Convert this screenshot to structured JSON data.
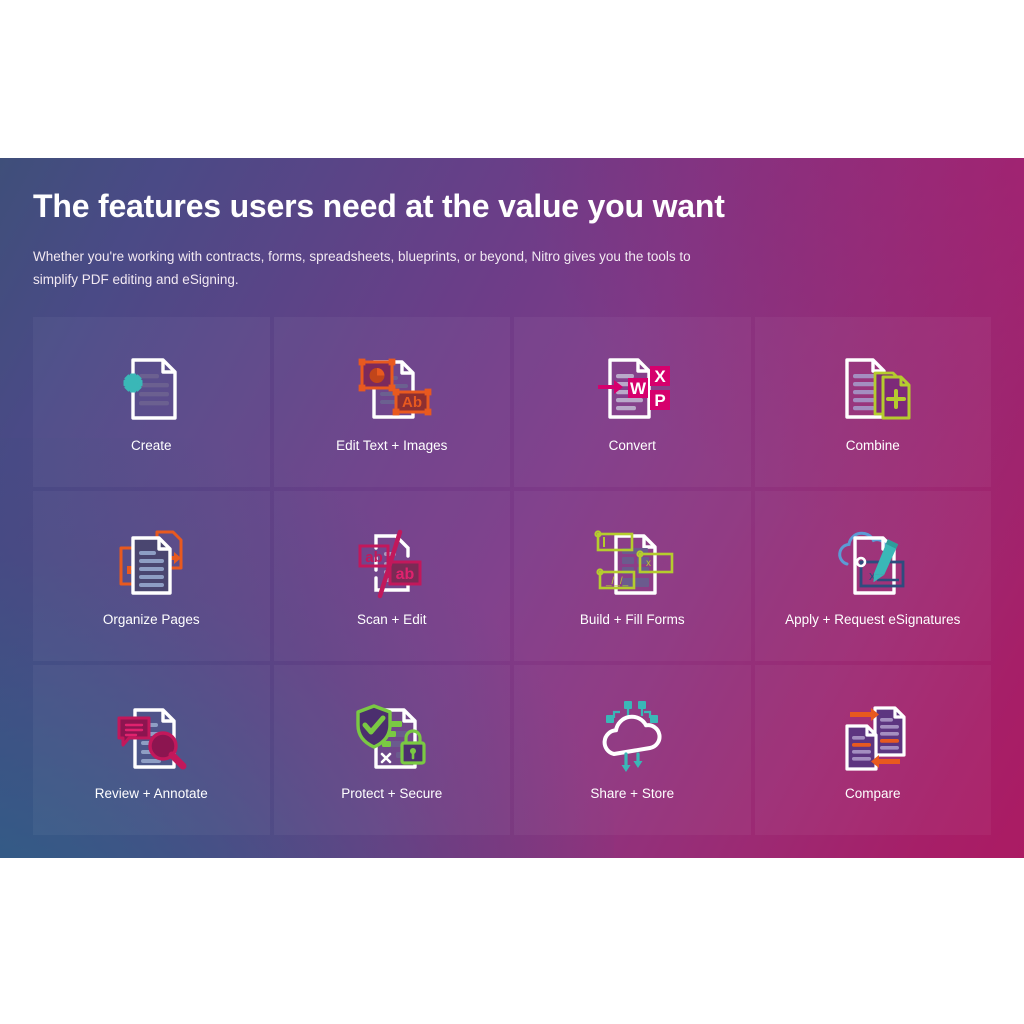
{
  "hero": {
    "title": "The features users need at the value you want",
    "subtitle": "Whether you're working with contracts, forms, spreadsheets, blueprints, or beyond, Nitro gives you the tools to simplify PDF editing and eSigning."
  },
  "colors": {
    "gradient_start": "#3f4f7a",
    "gradient_mid": "#7d3a88",
    "gradient_end": "#ab1b63",
    "teal": "#3ab7b7",
    "orange": "#e8591f",
    "magenta": "#d6006d",
    "crimson": "#c2185b",
    "lime": "#b5cc2e",
    "green": "#7ac943",
    "white": "#ffffff",
    "doc_line": "#6b6090"
  },
  "features": [
    {
      "label": "Create",
      "icon": "create-icon",
      "accent": "#3ab7b7"
    },
    {
      "label": "Edit Text + Images",
      "icon": "edit-text-images-icon",
      "accent": "#e8591f"
    },
    {
      "label": "Convert",
      "icon": "convert-icon",
      "accent": "#d6006d"
    },
    {
      "label": "Combine",
      "icon": "combine-icon",
      "accent": "#b5cc2e"
    },
    {
      "label": "Organize Pages",
      "icon": "organize-pages-icon",
      "accent": "#e8591f"
    },
    {
      "label": "Scan + Edit",
      "icon": "scan-edit-icon",
      "accent": "#c2185b"
    },
    {
      "label": "Build + Fill Forms",
      "icon": "build-fill-forms-icon",
      "accent": "#b5cc2e"
    },
    {
      "label": "Apply + Request eSignatures",
      "icon": "esignatures-icon",
      "accent": "#3ab7b7"
    },
    {
      "label": "Review + Annotate",
      "icon": "review-annotate-icon",
      "accent": "#c2185b"
    },
    {
      "label": "Protect + Secure",
      "icon": "protect-secure-icon",
      "accent": "#7ac943"
    },
    {
      "label": "Share + Store",
      "icon": "share-store-icon",
      "accent": "#3ab7b7"
    },
    {
      "label": "Compare",
      "icon": "compare-icon",
      "accent": "#e8591f"
    }
  ]
}
